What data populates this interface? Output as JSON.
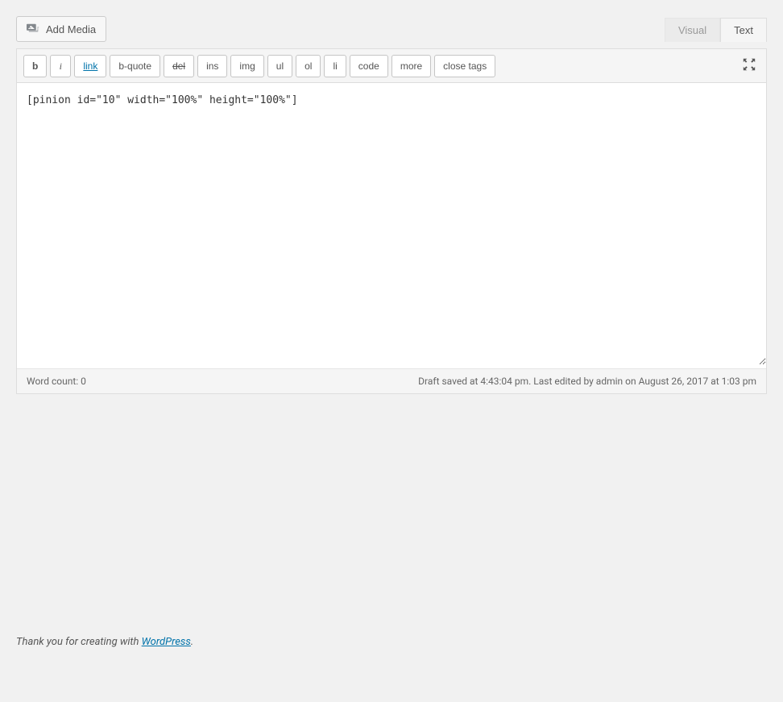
{
  "toolbar": {
    "add_media_label": "Add Media"
  },
  "tabs": {
    "visual": "Visual",
    "text": "Text"
  },
  "quicktags": {
    "bold": "b",
    "italic": "i",
    "link": "link",
    "bquote": "b-quote",
    "del": "del",
    "ins": "ins",
    "img": "img",
    "ul": "ul",
    "ol": "ol",
    "li": "li",
    "code": "code",
    "more": "more",
    "close": "close tags"
  },
  "content": {
    "value": "[pinion id=\"10\" width=\"100%\" height=\"100%\"]"
  },
  "status": {
    "word_count_label": "Word count: 0",
    "draft_info": "Draft saved at 4:43:04 pm. Last edited by admin on August 26, 2017 at 1:03 pm"
  },
  "footer": {
    "thank_you_prefix": "Thank you for creating with ",
    "wordpress_link": "WordPress",
    "period": "."
  }
}
